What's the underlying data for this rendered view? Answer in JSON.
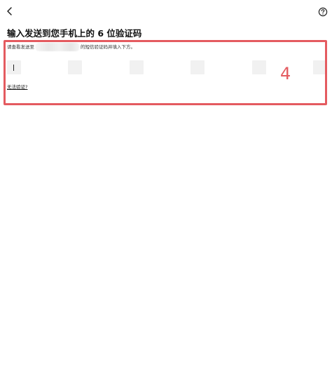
{
  "header": {
    "back_icon": "chevron-left-icon",
    "help_icon": "question-circle-icon"
  },
  "page": {
    "title": "输入发送到您手机上的 6 位验证码",
    "instruction_prefix": "请查看发送至",
    "instruction_suffix": "的短信验证码并填入下方。",
    "phone_number_blurred": true
  },
  "code_input": {
    "digit_count": 6,
    "digits": [
      "",
      "",
      "",
      "",
      "",
      ""
    ],
    "active_index": 0
  },
  "links": {
    "cant_verify": "无法验证?"
  },
  "annotation": {
    "label": "4",
    "color": "#e45b60"
  }
}
